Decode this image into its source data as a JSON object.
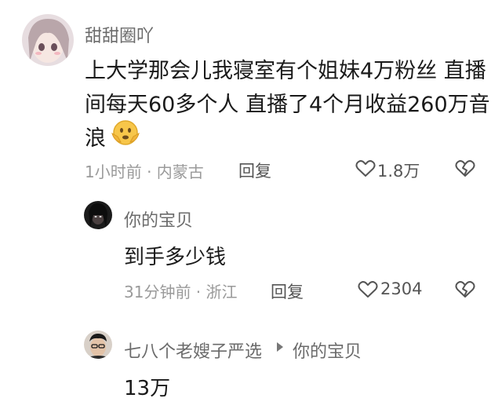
{
  "comment": {
    "username": "甜甜圈吖",
    "lines": [
      "上大学那会儿我寝室有个姐妹4万粉丝 直播",
      "间每天60多个人 直播了4个月收益260万音",
      "浪"
    ],
    "emoji": "scared-face",
    "time_location": "1小时前 · 内蒙古",
    "reply_label": "回复",
    "like_count": "1.8万"
  },
  "replies": [
    {
      "username": "你的宝贝",
      "text": "到手多少钱",
      "time_location": "31分钟前 · 浙江",
      "reply_label": "回复",
      "like_count": "2304"
    },
    {
      "username": "七八个老嫂子严选",
      "reply_to": "你的宝贝",
      "text": "13万"
    }
  ]
}
